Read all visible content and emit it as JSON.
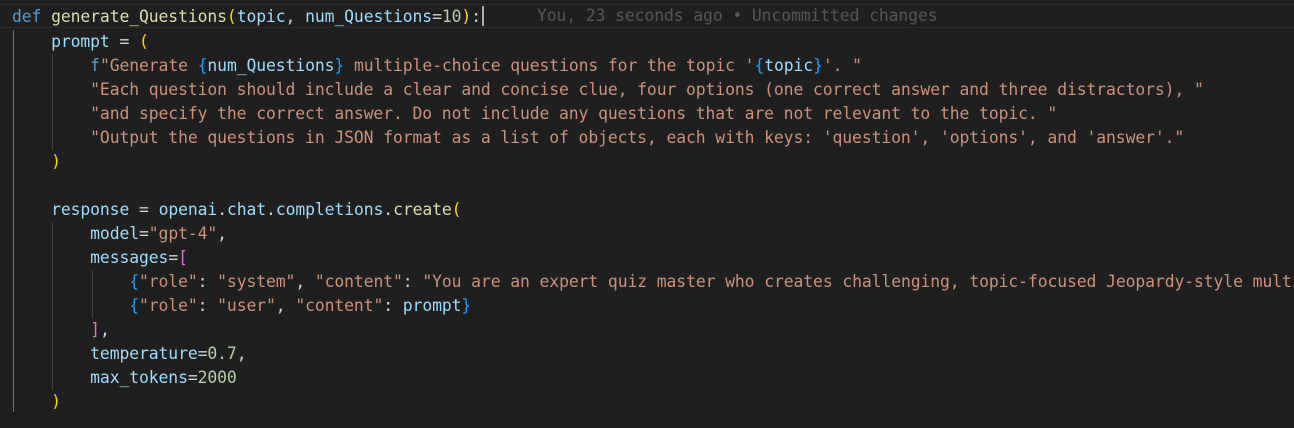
{
  "editor": {
    "blame": "You, 23 seconds ago • Uncommitted changes",
    "code": {
      "def": "def",
      "fn_name": "generate_Questions",
      "param_topic": "topic",
      "param_num": "num_Questions",
      "default_val": "10",
      "prompt_var": "prompt",
      "f_prefix": "f",
      "s1a": "\"Generate ",
      "s1_interp": "num_Questions",
      "s1b": " multiple-choice questions for the topic '",
      "s1_interp2": "topic",
      "s1c": "'. \"",
      "s2": "\"Each question should include a clear and concise clue, four options (one correct answer and three distractors), \"",
      "s3": "\"and specify the correct answer. Do not include any questions that are not relevant to the topic. \"",
      "s4": "\"Output the questions in JSON format as a list of objects, each with keys: 'question', 'options', and 'answer'.\"",
      "response_var": "response",
      "openai": "openai",
      "chat": "chat",
      "completions": "completions",
      "create": "create",
      "model_kw": "model",
      "model_val": "\"gpt-4\"",
      "messages_kw": "messages",
      "role_key": "\"role\"",
      "system_val": "\"system\"",
      "content_key": "\"content\"",
      "system_content": "\"You are an expert quiz master who creates challenging, topic-focused Jeopardy-style multip",
      "user_val": "\"user\"",
      "prompt_ref": "prompt",
      "temperature_kw": "temperature",
      "temperature_val": "0.7",
      "max_tokens_kw": "max_tokens",
      "max_tokens_val": "2000"
    }
  }
}
